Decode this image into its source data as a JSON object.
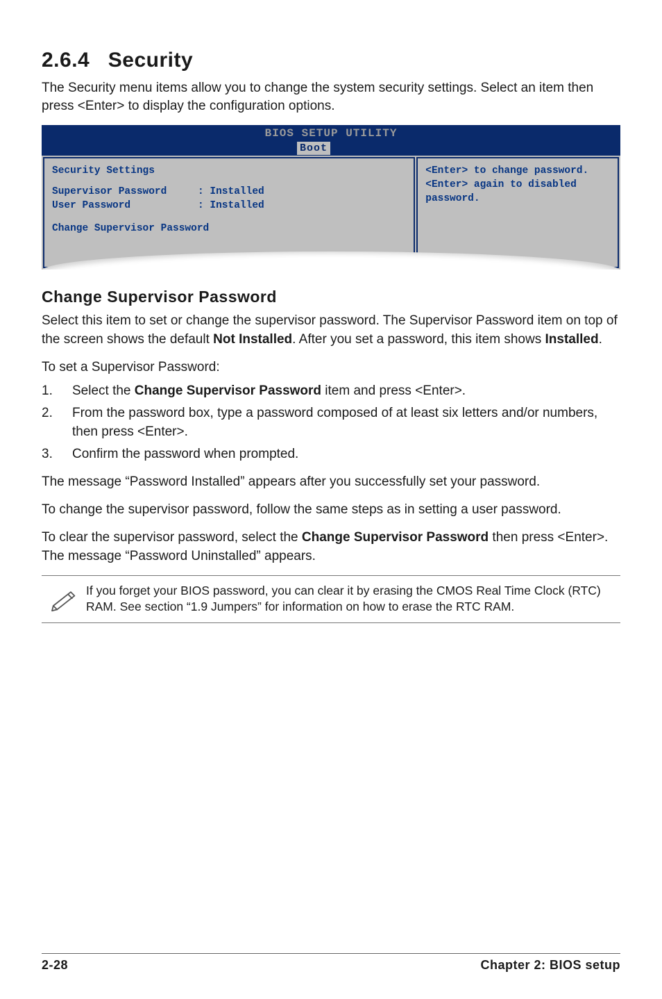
{
  "section_number": "2.6.4",
  "section_title": "Security",
  "intro_paragraph": "The Security menu items allow you to change the system security settings. Select an item then press <Enter> to display the configuration options.",
  "bios": {
    "banner": "BIOS SETUP UTILITY",
    "tab": "Boot",
    "left": {
      "heading": "Security Settings",
      "supervisor_label": "Supervisor Password",
      "supervisor_value": ": Installed",
      "user_label": "User Password",
      "user_value": ": Installed",
      "change_item": "Change Supervisor Password"
    },
    "right": {
      "line1": "<Enter> to change password.",
      "line2": "<Enter> again to disabled password."
    }
  },
  "sub_heading": "Change Supervisor Password",
  "para1_pre": "Select this item to set or change the supervisor password. The Supervisor Password item on top of the screen shows the default ",
  "para1_bold1": "Not Installed",
  "para1_mid": ". After you set a password, this item shows ",
  "para1_bold2": "Installed",
  "para1_post": ".",
  "para2": "To set a Supervisor Password:",
  "steps": {
    "s1_pre": "Select the ",
    "s1_bold": "Change Supervisor Password",
    "s1_post": " item and press <Enter>.",
    "s2": "From the password box, type a password composed of at least six letters and/or numbers, then press <Enter>.",
    "s3": "Confirm the password when prompted."
  },
  "para3": "The message “Password Installed” appears after you successfully set your password.",
  "para4": "To change the supervisor password, follow the same steps as in setting a user password.",
  "para5_pre": "To clear the supervisor password, select the ",
  "para5_bold": "Change Supervisor Password",
  "para5_post": " then press <Enter>. The message “Password Uninstalled” appears.",
  "note": "If you forget your BIOS password, you can clear it by erasing the CMOS Real Time Clock (RTC) RAM. See section “1.9  Jumpers” for information on how to erase the RTC RAM.",
  "footer_left": "2-28",
  "footer_right": "Chapter 2: BIOS setup"
}
